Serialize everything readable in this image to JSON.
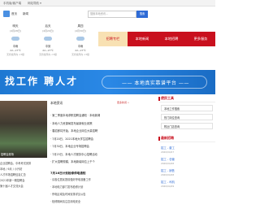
{
  "topbar": {
    "left_text": "手机版/客户端",
    "right_text": "网站导航 ▾"
  },
  "search": {
    "label1": "首页",
    "label2": "新闻",
    "placeholder": "搜索本地资讯...",
    "button": "搜索"
  },
  "weather": [
    {
      "day": "明天",
      "date": "(4月28日)",
      "condition": "中雨",
      "temp": "22~27℃",
      "wind": "无持续风向 <3级"
    },
    {
      "day": "后天",
      "date": "(4月29日)",
      "condition": "中到",
      "temp": "22~27℃",
      "wind": "无持续风向 <3级"
    },
    {
      "day": "周四",
      "date": "(4月30日)",
      "condition": "中雨",
      "temp": "22~27℃",
      "wind": "无持续风向 <3级"
    }
  ],
  "nav": {
    "tabs": [
      "招聘专栏",
      "本地新闻",
      "本地招聘",
      "更多服务"
    ],
    "active_index": 0
  },
  "banner": {
    "title": "找工作 聘人才",
    "tagline": "—— 本地真实靠谱平台 ——"
  },
  "photo": {
    "caption": "招聘会现场"
  },
  "left_list": {
    "items": [
      "企业招聘会，中考考试安排",
      "本地 / 6月 / 小升初",
      "人才市场招聘信息汇总",
      "2021年新一期招聘会",
      "第十届人才交流大会"
    ]
  },
  "news_head": {
    "title": "本地资讯",
    "meta": "更多新闻 »"
  },
  "news": {
    "items": [
      "· 第二季度本地求职招聘会通知 · 本地新闻",
      "· 本地人力资源局发布最新就业政策",
      "· 春招即将开始，本地企业岗位大量招聘",
      "· 7月20日，2021本地大学生招聘会",
      "· 7月30日，本地企业专场招聘会",
      "· 7月25日，本地人才服务中心招聘活动",
      "· 扩大招聘规模，本地新增岗位上千个"
    ]
  },
  "news_sub": {
    "heading": "7月16日计划检修停电通知",
    "items": [
      "· 请各位居民提前做好停电准备工作",
      "· 本地电力部门发布检修计划",
      "· 停电区域及时间安排详见公告",
      "· 检修期间请注意用电安全"
    ]
  },
  "side": {
    "tools_heading": "便民工具",
    "tools": [
      "本地工作搜索",
      "热门岗位查询",
      "附近门店查询"
    ],
    "jobs_heading": "最新招聘",
    "jobs": [
      {
        "title": "招工 - 普工",
        "date": "2020/04/27"
      },
      {
        "title": "招工 - 仓管",
        "date": "2020/04/28"
      },
      {
        "title": "招工 - 销售",
        "date": "2020/04/28"
      },
      {
        "title": "招工 - 司机",
        "date": "2020/04/29"
      }
    ]
  },
  "colors": {
    "nav_red": "#c9101e",
    "nav_active": "#e12a2a",
    "banner_blue": "#2a88e6",
    "link_blue": "#2e6bd6"
  }
}
